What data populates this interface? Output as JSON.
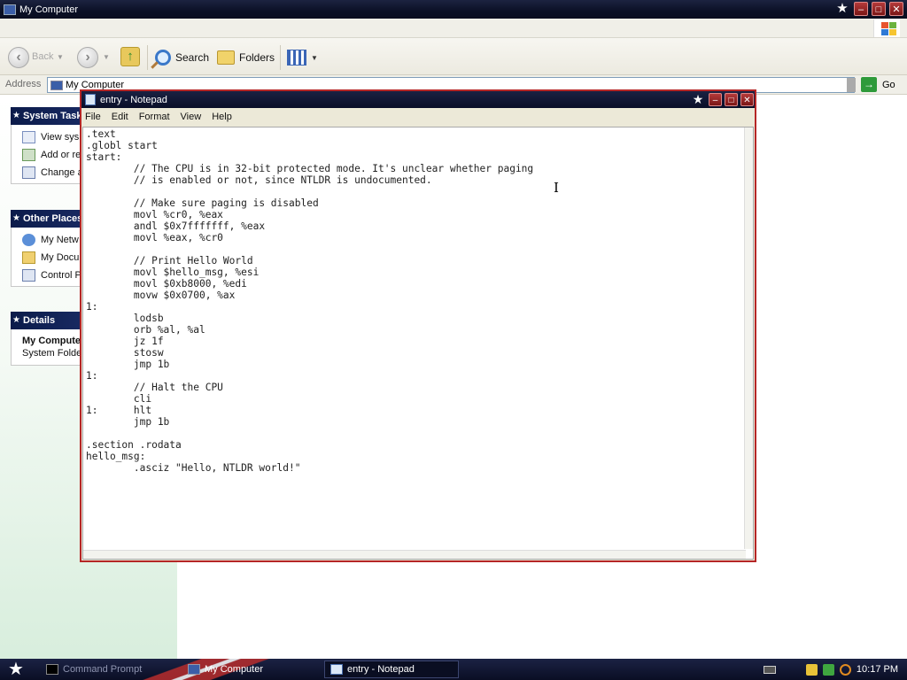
{
  "explorer": {
    "title": "My Computer",
    "toolbar": {
      "back_label": "Back",
      "search_label": "Search",
      "folders_label": "Folders"
    },
    "address": {
      "label": "Address",
      "value": "My Computer",
      "go_label": "Go"
    },
    "panels": {
      "system_tasks": {
        "title": "System Tasks",
        "items": [
          "View sys",
          "Add or re",
          "Change a"
        ]
      },
      "other_places": {
        "title": "Other Places",
        "items": [
          "My Netw",
          "My Docu",
          "Control P"
        ]
      },
      "details": {
        "title": "Details",
        "name": "My Compute",
        "type": "System Folde"
      }
    }
  },
  "notepad": {
    "title": "entry - Notepad",
    "menu": [
      "File",
      "Edit",
      "Format",
      "View",
      "Help"
    ],
    "content": ".text\n.globl start\nstart:\n        // The CPU is in 32-bit protected mode. It's unclear whether paging\n        // is enabled or not, since NTLDR is undocumented.\n\n        // Make sure paging is disabled\n        movl %cr0, %eax\n        andl $0x7fffffff, %eax\n        movl %eax, %cr0\n\n        // Print Hello World\n        movl $hello_msg, %esi\n        movl $0xb8000, %edi\n        movw $0x0700, %ax\n1:\n        lodsb\n        orb %al, %al\n        jz 1f\n        stosw\n        jmp 1b\n1:\n        // Halt the CPU\n        cli\n1:      hlt\n        jmp 1b\n\n.section .rodata\nhello_msg:\n        .asciz \"Hello, NTLDR world!\""
  },
  "taskbar": {
    "items": [
      {
        "label": "Command Prompt",
        "icon": "cmd-icon"
      },
      {
        "label": "My Computer",
        "icon": "computer-icon"
      },
      {
        "label": "entry - Notepad",
        "icon": "notepad-icon"
      }
    ],
    "clock": "10:17 PM"
  },
  "colors": {
    "title_bar": "#0b1026",
    "accent_red": "#b52626",
    "panel_header": "#0b1b4a"
  }
}
